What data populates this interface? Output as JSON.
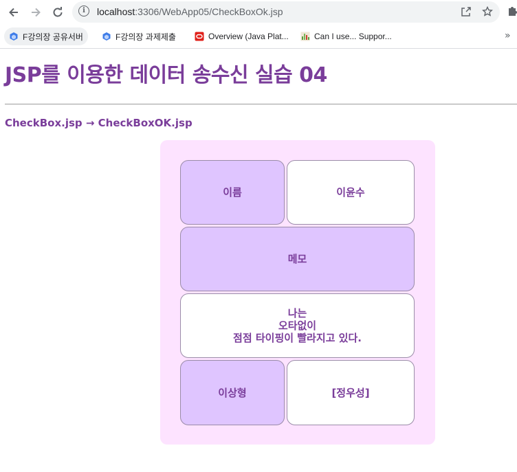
{
  "browser": {
    "url_host": "localhost",
    "url_path": ":3306/WebApp05/CheckBoxOk.jsp",
    "bookmarks": [
      {
        "label": "F강의장 공유서버",
        "icon": "cube-icon"
      },
      {
        "label": "F강의장 과제제출",
        "icon": "cube-icon"
      },
      {
        "label": "Overview (Java Plat...",
        "icon": "oracle-icon"
      },
      {
        "label": "Can I use... Suppor...",
        "icon": "caniuse-icon"
      }
    ],
    "more_label": "»"
  },
  "page": {
    "title": "JSP를 이용한 데이터 송수신 실습 04",
    "subtitle": "CheckBox.jsp → CheckBoxOK.jsp"
  },
  "table": {
    "name_label": "이름",
    "name_value": "이윤수",
    "memo_label": "메모",
    "memo_value": "나는\n오타없이\n점점 타이핑이 빨라지고 있다.",
    "ideal_label": "이상형",
    "ideal_value": "[정우성]"
  },
  "colors": {
    "accent_text": "#7a3d9a",
    "panel_bg": "#fde3ff",
    "header_cell_bg": "#dfc5ff",
    "value_cell_bg": "#ffffff"
  }
}
